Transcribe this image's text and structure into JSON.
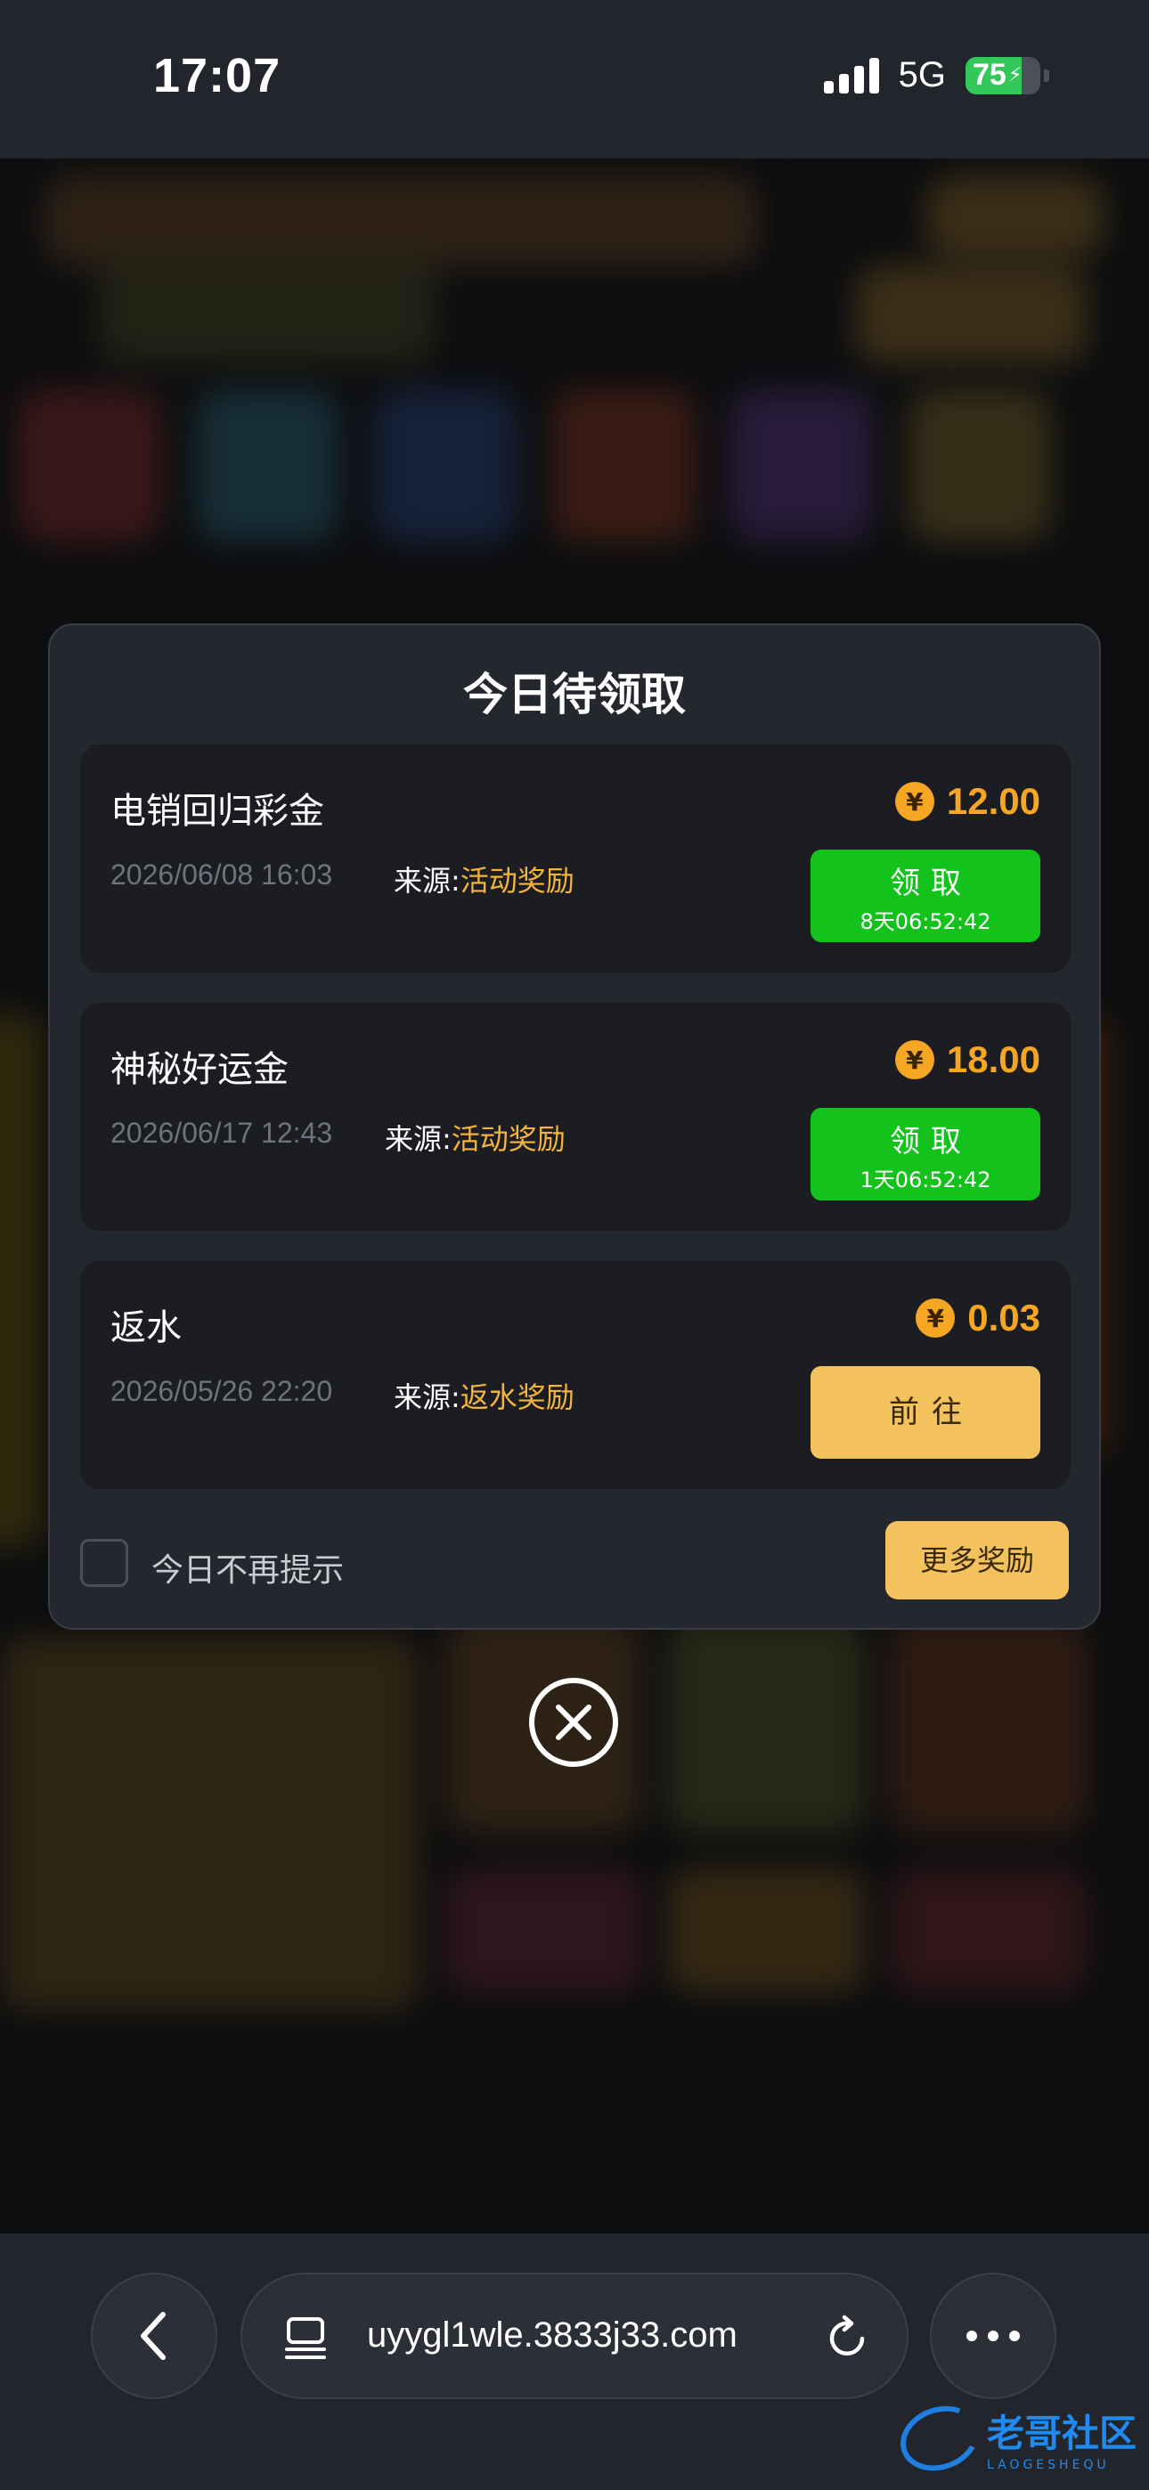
{
  "status": {
    "time": "17:07",
    "network": "5G",
    "battery": "75",
    "battery_level": 0.75
  },
  "modal": {
    "title": "今日待领取",
    "items": [
      {
        "name": "电销回归彩金",
        "date": "2026/06/08 16:03",
        "source_label": "来源:",
        "source_value": "活动奖励",
        "currency_symbol": "¥",
        "amount": "12.00",
        "button_label": "领取",
        "countdown": "8天06:52:42"
      },
      {
        "name": "神秘好运金",
        "date": "2026/06/17 12:43",
        "source_label": "来源:",
        "source_value": "活动奖励",
        "currency_symbol": "¥",
        "amount": "18.00",
        "button_label": "领取",
        "countdown": "1天06:52:42"
      },
      {
        "name": "返水",
        "date": "2026/05/26 22:20",
        "source_label": "来源:",
        "source_value": "返水奖励",
        "currency_symbol": "¥",
        "amount": "0.03",
        "button_label": "前往"
      }
    ],
    "dont_show_label": "今日不再提示",
    "more_button_label": "更多奖励"
  },
  "browser": {
    "url": "uyygl1wle.3833j33.com"
  },
  "watermark": {
    "cn": "老哥社区",
    "en": "LAOGESHEQU"
  },
  "colors": {
    "accent_gold": "#f5a623",
    "claim_green": "#14c21c",
    "button_gold": "#f3c25d",
    "modal_bg": "#25272e",
    "card_bg": "#1b1d23"
  }
}
